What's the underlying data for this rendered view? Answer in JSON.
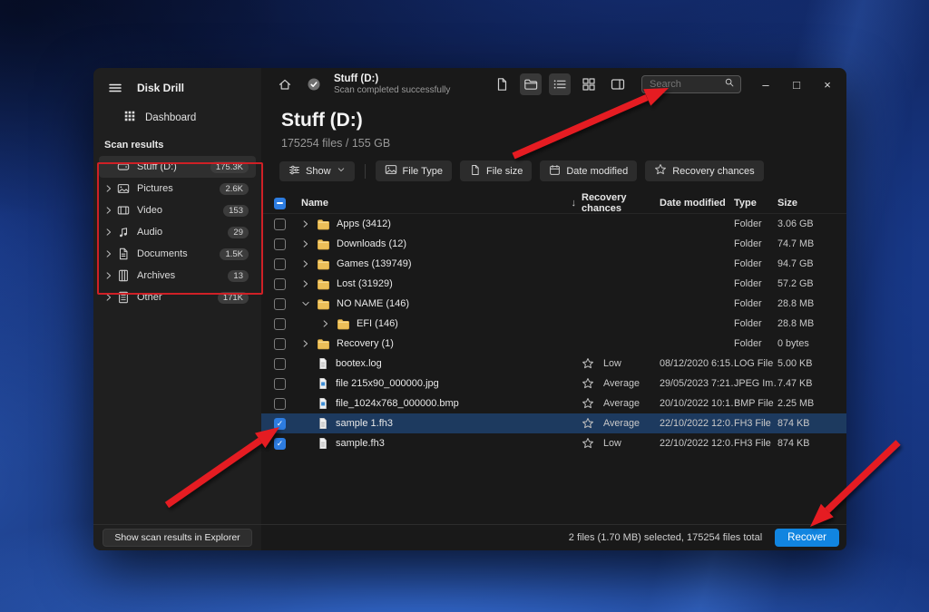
{
  "app": {
    "title": "Disk Drill"
  },
  "sidebar": {
    "dashboard_label": "Dashboard",
    "section_label": "Scan results",
    "items": [
      {
        "id": "stuff",
        "icon": "drive",
        "label": "Stuff (D:)",
        "count": "175.3K",
        "chevron": false,
        "selected": true
      },
      {
        "id": "pictures",
        "icon": "pictures",
        "label": "Pictures",
        "count": "2.6K",
        "chevron": true,
        "selected": false
      },
      {
        "id": "video",
        "icon": "video",
        "label": "Video",
        "count": "153",
        "chevron": true,
        "selected": false
      },
      {
        "id": "audio",
        "icon": "audio",
        "label": "Audio",
        "count": "29",
        "chevron": true,
        "selected": false
      },
      {
        "id": "documents",
        "icon": "documents",
        "label": "Documents",
        "count": "1.5K",
        "chevron": true,
        "selected": false
      },
      {
        "id": "archives",
        "icon": "archives",
        "label": "Archives",
        "count": "13",
        "chevron": true,
        "selected": false
      },
      {
        "id": "other",
        "icon": "other",
        "label": "Other",
        "count": "171K",
        "chevron": true,
        "selected": false
      }
    ],
    "footer_button": "Show scan results in Explorer"
  },
  "titlebar": {
    "drive_title": "Stuff (D:)",
    "scan_status": "Scan completed successfully",
    "search_placeholder": "Search",
    "minimize": "–",
    "maximize": "□",
    "close": "×"
  },
  "page": {
    "title": "Stuff (D:)",
    "subtitle": "175254 files / 155 GB"
  },
  "filters": {
    "show_label": "Show",
    "chips": [
      {
        "icon": "pictures",
        "label": "File Type"
      },
      {
        "icon": "filepage",
        "label": "File size"
      },
      {
        "icon": "calendar",
        "label": "Date modified"
      },
      {
        "icon": "star",
        "label": "Recovery chances"
      }
    ]
  },
  "table": {
    "columns": {
      "name": "Name",
      "recovery": "Recovery chances",
      "date": "Date modified",
      "type": "Type",
      "size": "Size"
    },
    "rows": [
      {
        "name": "Apps (3412)",
        "kind": "folder",
        "indent": 0,
        "expanded": false,
        "checked": false,
        "selected": false,
        "star": "",
        "recovery": "",
        "date": "",
        "type": "Folder",
        "size": "3.06 GB"
      },
      {
        "name": "Downloads (12)",
        "kind": "folder",
        "indent": 0,
        "expanded": false,
        "checked": false,
        "selected": false,
        "star": "",
        "recovery": "",
        "date": "",
        "type": "Folder",
        "size": "74.7 MB"
      },
      {
        "name": "Games (139749)",
        "kind": "folder",
        "indent": 0,
        "expanded": false,
        "checked": false,
        "selected": false,
        "star": "",
        "recovery": "",
        "date": "",
        "type": "Folder",
        "size": "94.7 GB"
      },
      {
        "name": "Lost (31929)",
        "kind": "folder",
        "indent": 0,
        "expanded": false,
        "checked": false,
        "selected": false,
        "star": "",
        "recovery": "",
        "date": "",
        "type": "Folder",
        "size": "57.2 GB"
      },
      {
        "name": "NO NAME (146)",
        "kind": "folder",
        "indent": 0,
        "expanded": true,
        "checked": false,
        "selected": false,
        "star": "",
        "recovery": "",
        "date": "",
        "type": "Folder",
        "size": "28.8 MB"
      },
      {
        "name": "EFI (146)",
        "kind": "folder",
        "indent": 1,
        "expanded": false,
        "checked": false,
        "selected": false,
        "star": "",
        "recovery": "",
        "date": "",
        "type": "Folder",
        "size": "28.8 MB"
      },
      {
        "name": "Recovery (1)",
        "kind": "folder",
        "indent": 0,
        "expanded": false,
        "checked": false,
        "selected": false,
        "star": "",
        "recovery": "",
        "date": "",
        "type": "Folder",
        "size": "0 bytes"
      },
      {
        "name": "bootex.log",
        "kind": "file-text",
        "indent": 0,
        "expanded": false,
        "checked": false,
        "selected": false,
        "star": "outline",
        "recovery": "Low",
        "date": "08/12/2020 6:15…",
        "type": "LOG File",
        "size": "5.00 KB"
      },
      {
        "name": "file 215x90_000000.jpg",
        "kind": "file-image",
        "indent": 0,
        "expanded": false,
        "checked": false,
        "selected": false,
        "star": "half",
        "recovery": "Average",
        "date": "29/05/2023 7:21…",
        "type": "JPEG Im…",
        "size": "7.47 KB"
      },
      {
        "name": "file_1024x768_000000.bmp",
        "kind": "file-image",
        "indent": 0,
        "expanded": false,
        "checked": false,
        "selected": false,
        "star": "half",
        "recovery": "Average",
        "date": "20/10/2022 10:1…",
        "type": "BMP File",
        "size": "2.25 MB"
      },
      {
        "name": "sample 1.fh3",
        "kind": "file-text",
        "indent": 0,
        "expanded": false,
        "checked": true,
        "selected": true,
        "star": "half",
        "recovery": "Average",
        "date": "22/10/2022 12:0…",
        "type": "FH3 File",
        "size": "874 KB"
      },
      {
        "name": "sample.fh3",
        "kind": "file-text",
        "indent": 0,
        "expanded": false,
        "checked": true,
        "selected": false,
        "star": "outline",
        "recovery": "Low",
        "date": "22/10/2022 12:0…",
        "type": "FH3 File",
        "size": "874 KB"
      }
    ]
  },
  "footer": {
    "status": "2 files (1.70 MB) selected, 175254 files total",
    "recover_label": "Recover"
  },
  "annotations": {
    "arrow_color": "#e51c23",
    "rect_color": "#cf2026"
  }
}
